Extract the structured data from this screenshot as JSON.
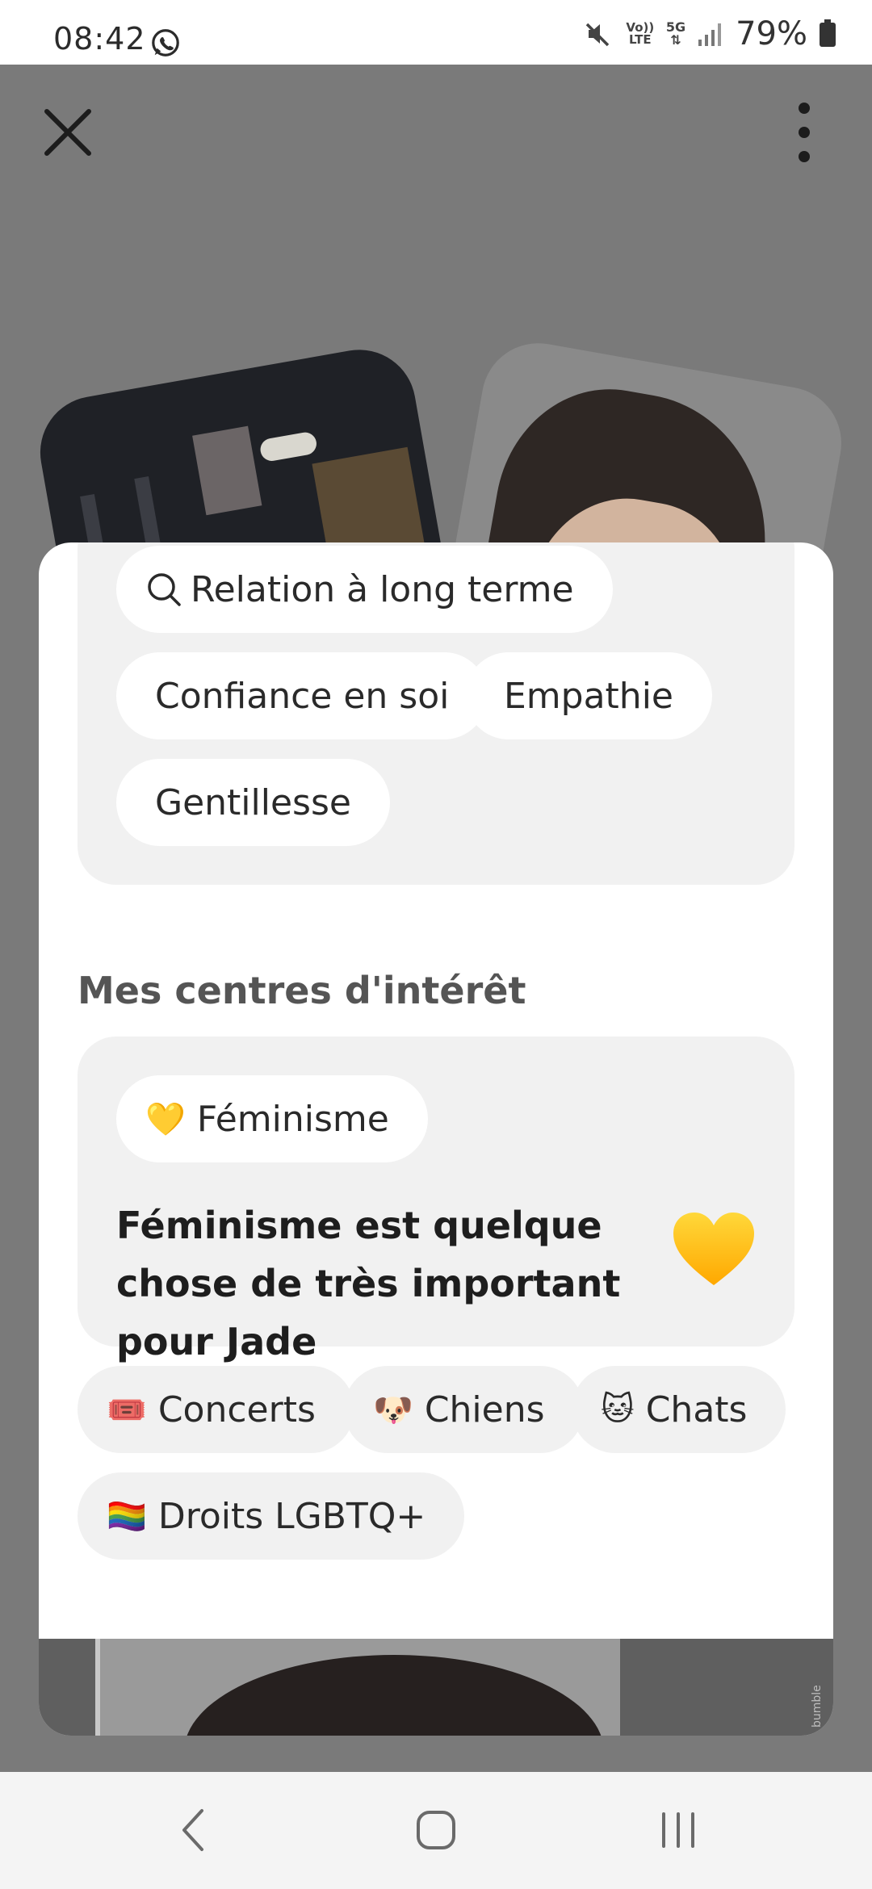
{
  "status_bar": {
    "time": "08:42",
    "network_label": "Vo)) LTE",
    "network_type": "5G",
    "battery": "79%"
  },
  "top_bar": {
    "close_icon": "close-icon",
    "more_icon": "more-vertical-icon"
  },
  "looking_for": {
    "chips": [
      {
        "icon": "search-icon",
        "label": "Relation à long terme"
      },
      {
        "label": "Confiance en soi"
      },
      {
        "label": "Empathie"
      },
      {
        "label": "Gentillesse"
      }
    ]
  },
  "interests": {
    "title": "Mes centres d'intérêt",
    "featured": {
      "emoji": "💛",
      "label": "Féminisme",
      "statement": "Féminisme est quelque chose de très important pour Jade"
    },
    "chips": [
      {
        "emoji": "🎟️",
        "label": "Concerts"
      },
      {
        "emoji": "🐶",
        "label": "Chiens"
      },
      {
        "emoji": "🐱",
        "label": "Chats"
      },
      {
        "emoji": "🏳️‍🌈",
        "label": "Droits LGBTQ+"
      }
    ]
  },
  "watermark": "bumble",
  "nav_bar": {
    "back_icon": "back-icon",
    "home_icon": "home-icon",
    "recents_icon": "recents-icon"
  },
  "colors": {
    "backdrop": "#7a7a7a",
    "sheet": "#ffffff",
    "card": "#f1f1f1",
    "heart": "#ffc21a"
  }
}
